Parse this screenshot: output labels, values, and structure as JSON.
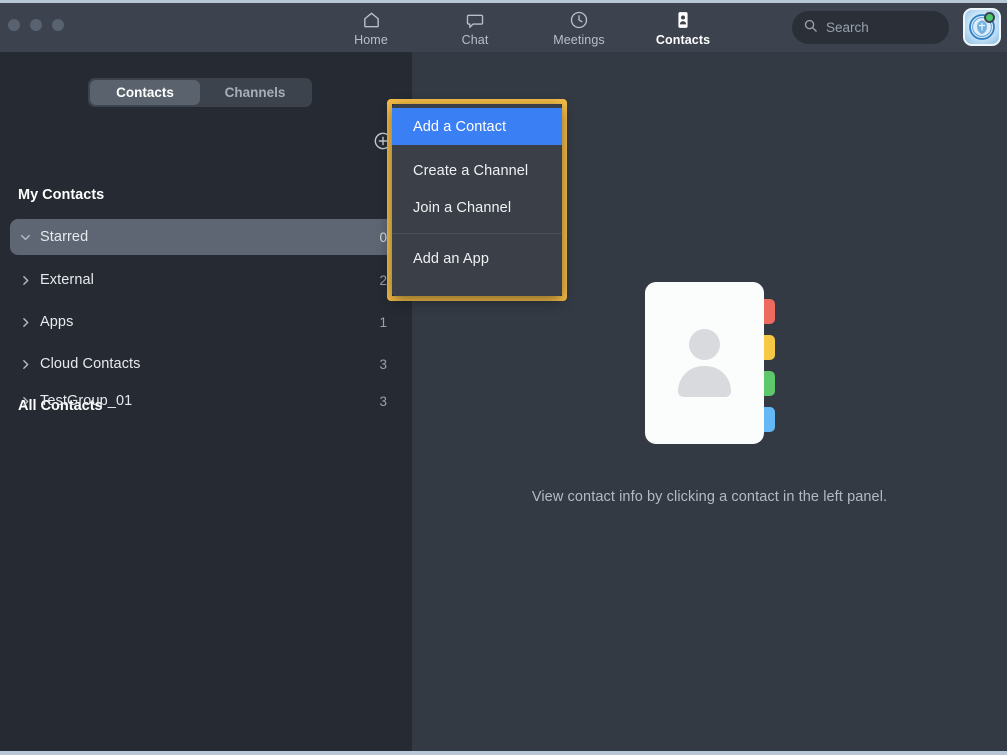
{
  "window": {
    "traffic_lights": [
      "close",
      "minimize",
      "maximize"
    ]
  },
  "titlebar": {
    "nav": [
      {
        "id": "home",
        "label": "Home",
        "icon": "home-icon",
        "active": false
      },
      {
        "id": "chat",
        "label": "Chat",
        "icon": "chat-icon",
        "active": false
      },
      {
        "id": "meetings",
        "label": "Meetings",
        "icon": "clock-icon",
        "active": false
      },
      {
        "id": "contacts",
        "label": "Contacts",
        "icon": "contacts-icon",
        "active": true
      }
    ],
    "search": {
      "placeholder": "Search",
      "value": "",
      "icon": "search-icon"
    },
    "avatar": {
      "name": "user-avatar",
      "presence": "available"
    }
  },
  "sidebar": {
    "segmented": {
      "tabs": [
        {
          "id": "contacts",
          "label": "Contacts",
          "active": true
        },
        {
          "id": "channels",
          "label": "Channels",
          "active": false
        }
      ]
    },
    "add_button": {
      "label": "Add",
      "icon": "plus-circle-icon"
    },
    "sections": [
      {
        "title": "My Contacts",
        "items": [
          {
            "label": "Starred",
            "count": "0",
            "expanded": true,
            "selected": true
          },
          {
            "label": "External",
            "count": "2",
            "expanded": false,
            "selected": false
          },
          {
            "label": "Apps",
            "count": "1",
            "expanded": false,
            "selected": false
          },
          {
            "label": "Cloud Contacts",
            "count": "3",
            "expanded": false,
            "selected": false
          }
        ]
      },
      {
        "title": "All Contacts",
        "items": [
          {
            "label": "TestGroup_01",
            "count": "3",
            "expanded": false,
            "selected": false
          }
        ]
      }
    ]
  },
  "context_menu": {
    "items": [
      {
        "label": "Add a Contact",
        "highlighted": true
      },
      {
        "label": "Create a Channel",
        "highlighted": false
      },
      {
        "label": "Join a Channel",
        "highlighted": false
      },
      {
        "label": "Add an App",
        "highlighted": false
      }
    ]
  },
  "main": {
    "empty_state": {
      "message": "View contact info by clicking a contact in the left panel.",
      "illustration": "address-book-icon",
      "tab_colors": [
        "#ec6b5e",
        "#f6c944",
        "#5fc76b",
        "#63b8f5"
      ]
    }
  },
  "colors": {
    "accent_blue": "#3b7ff5",
    "highlight_yellow": "#f5bd48",
    "sidebar_bg": "#262b33",
    "main_bg": "#343a44",
    "titlebar_bg": "#3c434e"
  }
}
